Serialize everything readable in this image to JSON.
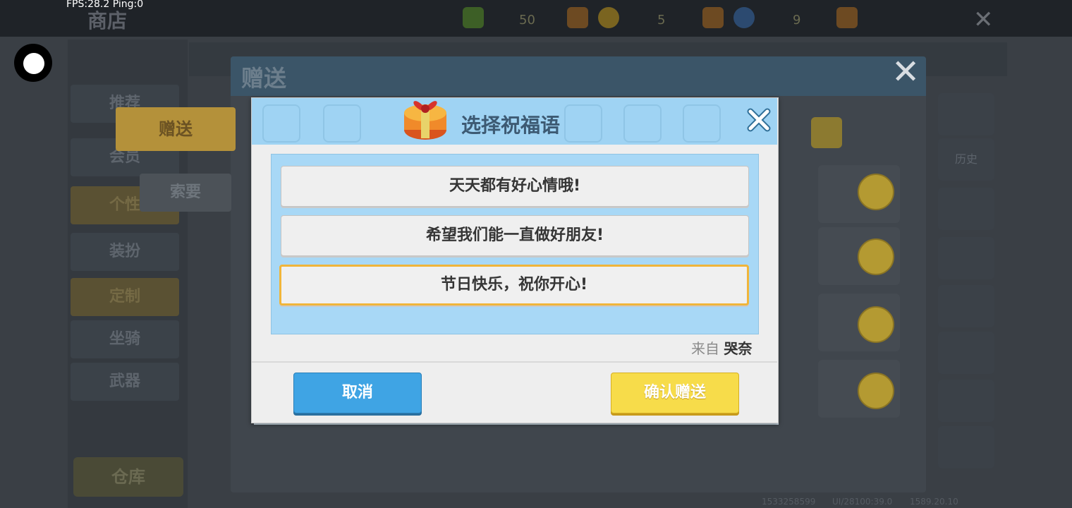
{
  "overlay": {
    "fps_text": "FPS:28.2  Ping:0"
  },
  "shop": {
    "title": "商店",
    "currencies": [
      {
        "icon": "green-gem-icon",
        "value": "50",
        "color": "#4a7a2a"
      },
      {
        "icon": "coin-icon",
        "value": "5",
        "color": "#8a7124"
      },
      {
        "icon": "blue-gem-icon",
        "value": "9",
        "color": "#345a86"
      }
    ],
    "left_nav": [
      {
        "label": "推荐"
      },
      {
        "label": "会员"
      },
      {
        "label": "个性"
      },
      {
        "label": "装扮"
      },
      {
        "label": "定制"
      },
      {
        "label": "坐骑"
      },
      {
        "label": "武器"
      }
    ],
    "warehouse_label": "仓库",
    "right_tools": [
      {
        "label": ""
      },
      {
        "label": "历史"
      }
    ],
    "footer_info": [
      "1533258599",
      "UI/28100:39.0",
      "1589.20.10"
    ]
  },
  "gift_window": {
    "title": "赠送",
    "tab_give": "赠送",
    "tab_ask": "索要"
  },
  "dialog": {
    "title": "选择祝福语",
    "options": [
      {
        "text": "天天都有好心情哦!"
      },
      {
        "text": "希望我们能一直做好朋友!"
      },
      {
        "text": "节日快乐，祝你开心!"
      }
    ],
    "selected_index": 2,
    "from_label": "来自",
    "from_name": "哭奈",
    "cancel_label": "取消",
    "confirm_label": "确认赠送",
    "colors": {
      "header": "#9fd3f3",
      "list_bg": "#a8d8f6",
      "selected_border": "#f0b53a",
      "cancel": "#3fa4e4",
      "confirm": "#f7dc4a"
    }
  }
}
